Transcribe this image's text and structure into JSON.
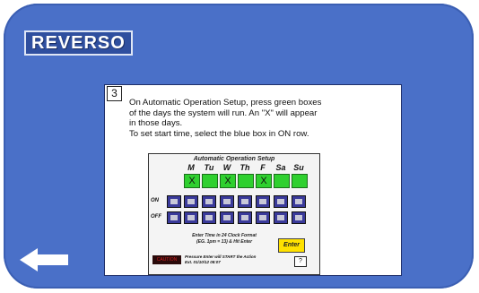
{
  "brand": {
    "logo_text": "REVERSO"
  },
  "step": {
    "number": "3"
  },
  "instructions": {
    "line1": "On Automatic Operation Setup, press green boxes",
    "line2": "of the days the system will run. An \"X\" will appear",
    "line3": "in those days.",
    "line4": "To set start time, select the blue box in ON row."
  },
  "panel": {
    "title": "Automatic Operation Setup",
    "days": [
      {
        "label": "M",
        "mark": "X"
      },
      {
        "label": "Tu",
        "mark": ""
      },
      {
        "label": "W",
        "mark": "X"
      },
      {
        "label": "Th",
        "mark": ""
      },
      {
        "label": "F",
        "mark": "X"
      },
      {
        "label": "Sa",
        "mark": ""
      },
      {
        "label": "Su",
        "mark": ""
      }
    ],
    "on_label": "ON",
    "off_label": "OFF",
    "hint_line1": "Enter Time in 24 Clock Format",
    "hint_line2": "(EG. 1pm = 13) & Hit Enter",
    "enter_label": "Enter",
    "status_badge": "CAUTION",
    "status_line1": "Pressure Enter will START the Action",
    "status_line2": "Ext.    01/10/12  08:07",
    "help_label": "?"
  },
  "icons": {
    "back": "arrow-left-icon"
  },
  "colors": {
    "frame": "#4a70c8",
    "day_box": "#2fd02f",
    "time_box": "#3a3a9a",
    "enter_button": "#ffe100"
  }
}
